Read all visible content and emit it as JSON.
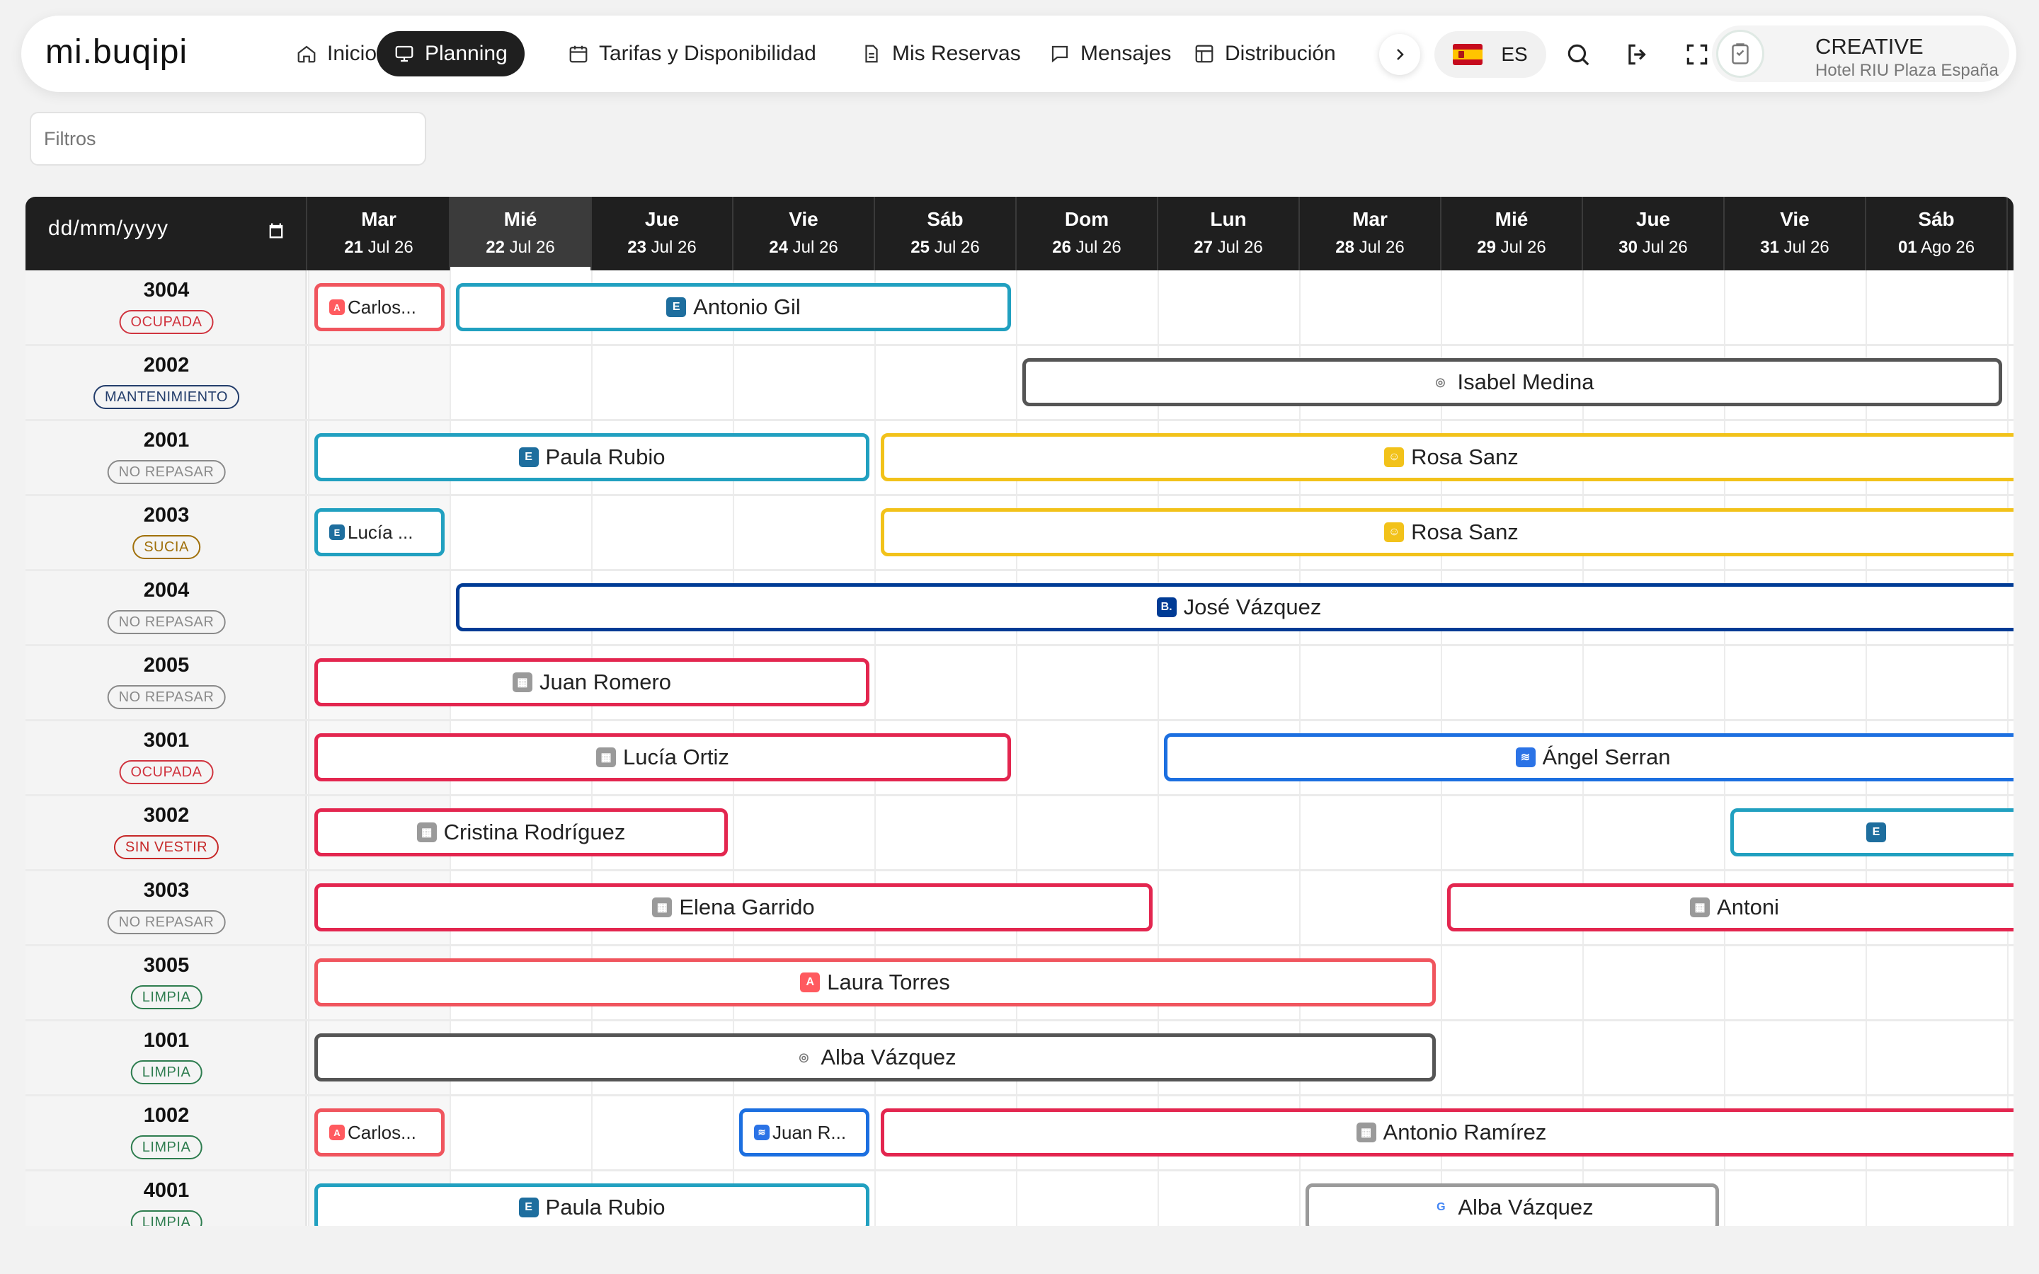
{
  "app": {
    "logo": "mi.buqipi",
    "nav": [
      {
        "label": "Inicio",
        "icon": "home-icon",
        "active": false
      },
      {
        "label": "Planning",
        "icon": "monitor-icon",
        "active": true
      },
      {
        "label": "Tarifas y Disponibilidad",
        "icon": "calendar-icon",
        "active": false
      },
      {
        "label": "Mis Reservas",
        "icon": "document-icon",
        "active": false
      },
      {
        "label": "Mensajes",
        "icon": "chat-icon",
        "active": false
      },
      {
        "label": "Distribución",
        "icon": "layout-icon",
        "active": false
      }
    ],
    "language": "ES",
    "user": {
      "name": "CREATIVE",
      "hotel": "Hotel RIU Plaza España"
    }
  },
  "filters": {
    "placeholder": "Filtros"
  },
  "planner": {
    "date_placeholder": "dd/mm/yyyy",
    "days": [
      {
        "name": "Mar",
        "day": "21",
        "month": "Jul 26"
      },
      {
        "name": "Mié",
        "day": "22",
        "month": "Jul 26",
        "today": true
      },
      {
        "name": "Jue",
        "day": "23",
        "month": "Jul 26"
      },
      {
        "name": "Vie",
        "day": "24",
        "month": "Jul 26"
      },
      {
        "name": "Sáb",
        "day": "25",
        "month": "Jul 26"
      },
      {
        "name": "Dom",
        "day": "26",
        "month": "Jul 26"
      },
      {
        "name": "Lun",
        "day": "27",
        "month": "Jul 26"
      },
      {
        "name": "Mar",
        "day": "28",
        "month": "Jul 26"
      },
      {
        "name": "Mié",
        "day": "29",
        "month": "Jul 26"
      },
      {
        "name": "Jue",
        "day": "30",
        "month": "Jul 26"
      },
      {
        "name": "Vie",
        "day": "31",
        "month": "Jul 26"
      },
      {
        "name": "Sáb",
        "day": "01",
        "month": "Ago 26"
      }
    ],
    "status_colors": {
      "OCUPADA": "#d0343f",
      "MANTENIMIENTO": "#233d6b",
      "NO REPASAR": "#8a8a8a",
      "SUCIA": "#a0700a",
      "SIN VESTIR": "#c62828",
      "LIMPIA": "#2e7d4f"
    },
    "channels": {
      "airbnb": {
        "border": "#f0555e",
        "icon": "airbnb-icon",
        "glyph": "A",
        "bg": "#ff5a5f"
      },
      "expedia": {
        "border": "#21a0c0",
        "icon": "expedia-icon",
        "glyph": "E",
        "bg": "#1e6e9e"
      },
      "direct": {
        "border": "#555555",
        "icon": "direct-icon",
        "glyph": "◎",
        "bg": "#ffffff"
      },
      "hotelbeds": {
        "border": "#f2c21a",
        "icon": "hotelbeds-icon",
        "glyph": "☺",
        "bg": "#f2c21a"
      },
      "booking": {
        "border": "#003b95",
        "icon": "booking-icon",
        "glyph": "B.",
        "bg": "#003b95"
      },
      "hotel": {
        "border": "#e3264f",
        "icon": "hotel-icon",
        "glyph": "▦",
        "bg": "#9a9a9a"
      },
      "tripadvisor": {
        "border": "#1c6fe0",
        "icon": "blue-channel-icon",
        "glyph": "≋",
        "bg": "#2b73e6"
      },
      "google": {
        "border": "#9a9a9a",
        "icon": "google-icon",
        "glyph": "G",
        "bg": "#ffffff"
      }
    },
    "rooms": [
      {
        "number": "3004",
        "status": "OCUPADA",
        "reservations": [
          {
            "guest": "Carlos...",
            "channel": "airbnb",
            "start": 0,
            "span": 1,
            "small": true
          },
          {
            "guest": "Antonio Gil",
            "channel": "expedia",
            "start": 1,
            "span": 4
          }
        ]
      },
      {
        "number": "2002",
        "status": "MANTENIMIENTO",
        "reservations": [
          {
            "guest": "Isabel Medina",
            "channel": "direct",
            "start": 5,
            "span": 7
          }
        ]
      },
      {
        "number": "2001",
        "status": "NO REPASAR",
        "reservations": [
          {
            "guest": "Paula Rubio",
            "channel": "expedia",
            "start": 0,
            "span": 4
          },
          {
            "guest": "Rosa Sanz",
            "channel": "hotelbeds",
            "start": 4,
            "span": 8,
            "open_end": true
          }
        ]
      },
      {
        "number": "2003",
        "status": "SUCIA",
        "reservations": [
          {
            "guest": "Lucía ...",
            "channel": "expedia",
            "start": 0,
            "span": 1,
            "small": true
          },
          {
            "guest": "Rosa Sanz",
            "channel": "hotelbeds",
            "start": 4,
            "span": 8,
            "open_end": true
          }
        ]
      },
      {
        "number": "2004",
        "status": "NO REPASAR",
        "reservations": [
          {
            "guest": "José Vázquez",
            "channel": "booking",
            "start": 1,
            "span": 11,
            "open_end": true
          }
        ]
      },
      {
        "number": "2005",
        "status": "NO REPASAR",
        "reservations": [
          {
            "guest": "Juan Romero",
            "channel": "hotel",
            "start": 0,
            "span": 4
          }
        ]
      },
      {
        "number": "3001",
        "status": "OCUPADA",
        "reservations": [
          {
            "guest": "Lucía Ortiz",
            "channel": "hotel",
            "start": 0,
            "span": 5
          },
          {
            "guest": "Ángel Serran",
            "channel": "tripadvisor",
            "start": 6,
            "span": 6,
            "open_end": true
          }
        ]
      },
      {
        "number": "3002",
        "status": "SIN VESTIR",
        "reservations": [
          {
            "guest": "Cristina Rodríguez",
            "channel": "hotel",
            "start": 0,
            "span": 3
          },
          {
            "guest": "",
            "channel": "expedia",
            "start": 10,
            "span": 2,
            "open_end": true
          }
        ]
      },
      {
        "number": "3003",
        "status": "NO REPASAR",
        "reservations": [
          {
            "guest": "Elena Garrido",
            "channel": "hotel",
            "start": 0,
            "span": 6
          },
          {
            "guest": "Antoni",
            "channel": "hotel",
            "start": 8,
            "span": 4,
            "open_end": true
          }
        ]
      },
      {
        "number": "3005",
        "status": "LIMPIA",
        "reservations": [
          {
            "guest": "Laura Torres",
            "channel": "airbnb",
            "start": 0,
            "span": 8
          }
        ]
      },
      {
        "number": "1001",
        "status": "LIMPIA",
        "reservations": [
          {
            "guest": "Alba Vázquez",
            "channel": "direct",
            "start": 0,
            "span": 8
          }
        ]
      },
      {
        "number": "1002",
        "status": "LIMPIA",
        "reservations": [
          {
            "guest": "Carlos...",
            "channel": "airbnb",
            "start": 0,
            "span": 1,
            "small": true
          },
          {
            "guest": "Juan R...",
            "channel": "tripadvisor",
            "start": 3,
            "span": 1,
            "small": true
          },
          {
            "guest": "Antonio Ramírez",
            "channel": "hotel",
            "start": 4,
            "span": 8,
            "open_end": true
          }
        ]
      },
      {
        "number": "4001",
        "status": "LIMPIA",
        "reservations": [
          {
            "guest": "Paula Rubio",
            "channel": "expedia",
            "start": 0,
            "span": 4
          },
          {
            "guest": "Alba Vázquez",
            "channel": "google",
            "start": 7,
            "span": 3
          }
        ]
      }
    ]
  }
}
